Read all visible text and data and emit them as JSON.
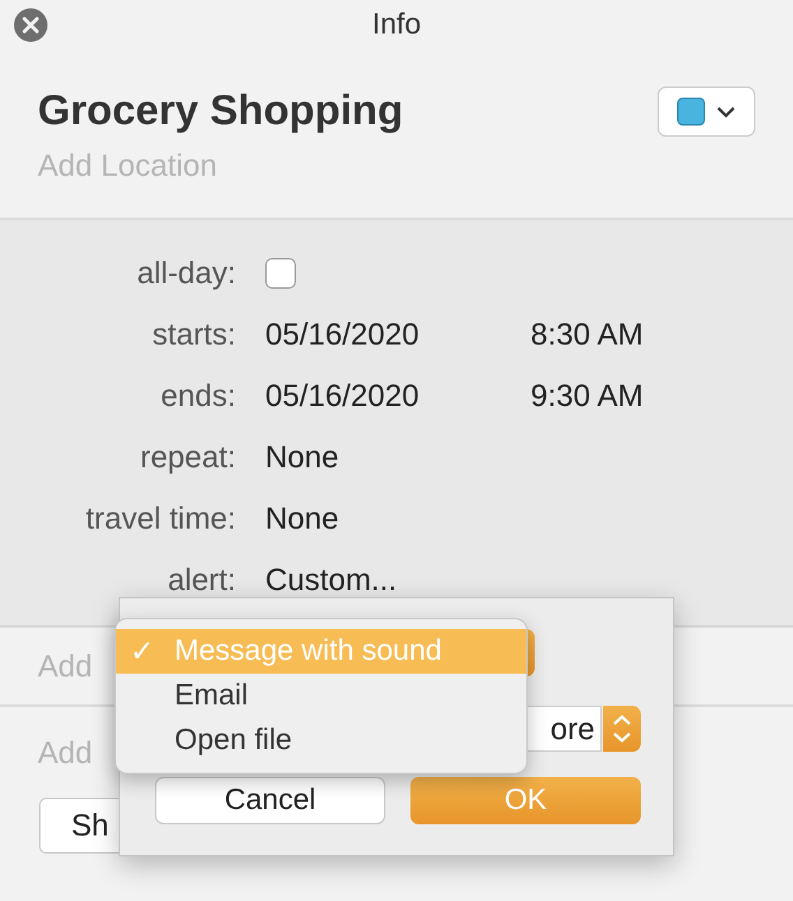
{
  "window": {
    "title": "Info"
  },
  "event": {
    "title": "Grocery Shopping",
    "location_placeholder": "Add Location"
  },
  "fields": [
    {
      "kind": "checkbox",
      "label": "all-day:",
      "checked": false
    },
    {
      "kind": "datetime",
      "label": "starts:",
      "date": "05/16/2020",
      "time": "8:30 AM"
    },
    {
      "kind": "datetime",
      "label": "ends:",
      "date": "05/16/2020",
      "time": "9:30 AM"
    },
    {
      "kind": "text",
      "label": "repeat:",
      "value": "None"
    },
    {
      "kind": "text",
      "label": "travel time:",
      "value": "None"
    },
    {
      "kind": "text",
      "label": "alert:",
      "value": "Custom..."
    }
  ],
  "sections": [
    {
      "placeholder": "Add"
    },
    {
      "placeholder": "Add"
    }
  ],
  "show_button": "Sh",
  "alert_sheet": {
    "field_value": "ore",
    "buttons": [
      {
        "label": "Cancel",
        "default": false
      },
      {
        "label": "OK",
        "default": true
      }
    ]
  },
  "menu": {
    "checkmark": "✓",
    "items": [
      {
        "label": "Message with sound",
        "selected": true
      },
      {
        "label": "Email",
        "selected": false
      },
      {
        "label": "Open file",
        "selected": false
      }
    ]
  }
}
